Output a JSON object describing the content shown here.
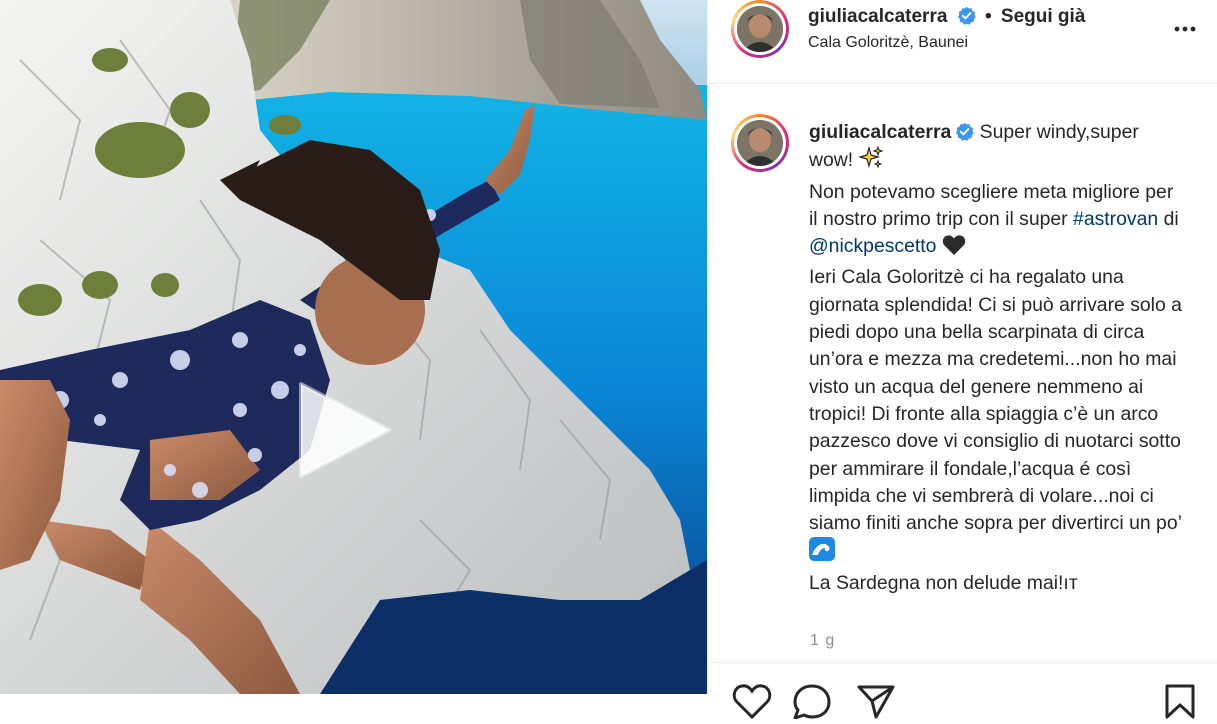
{
  "post": {
    "username": "giuliacalcaterra",
    "follow_separator": "•",
    "follow_state": "Segui già",
    "location": "Cala Goloritzè, Baunei",
    "more_label": "...",
    "timestamp": "1 g"
  },
  "caption": {
    "username": "giuliacalcaterra",
    "line1": "Super windy,super wow!",
    "line2_prefix": "Non potevamo scegliere meta migliore per il nostro primo trip con il super",
    "hashtag": "#astrovan",
    "word_di": "di",
    "mention": "@nickpescetto",
    "body": "Ieri Cala Goloritzè ci ha regalato una giornata splendida! Ci si può arrivare solo a piedi dopo una bella scarpinata di circa un’ora e mezza ma credetemi...non ho mai visto un acqua del genere nemmeno ai tropici! Di fronte alla spiaggia c’è un arco pazzesco dove vi consiglio di nuotarci sotto per ammirare il fondale,l’acqua é così limpida che vi sembrerà di volare...noi ci siamo finiti anche sopra per divertirci un po’",
    "closing": "La Sardegna non delude mai!ıт"
  },
  "icons": {
    "verified": "verified-badge-icon",
    "more": "more-options-icon",
    "sparkles": "sparkles-emoji-icon",
    "black_heart": "black-heart-emoji-icon",
    "wave": "wave-emoji-icon",
    "play": "play-icon",
    "like": "heart-outline-icon",
    "comment": "comment-icon",
    "share": "share-icon",
    "save": "bookmark-icon"
  },
  "colors": {
    "verified_blue": "#3897f0",
    "link_blue": "#00376b",
    "muted_gray": "#8e8e8e",
    "text": "#262626"
  }
}
